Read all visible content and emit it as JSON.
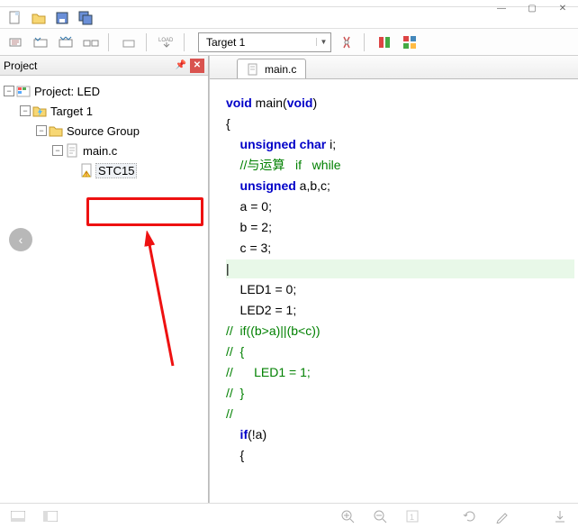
{
  "window": {
    "min": "—",
    "max": "▢",
    "close": "✕"
  },
  "toolbar": {
    "target_label": "Target 1"
  },
  "project": {
    "panel_title": "Project",
    "root": "Project: LED",
    "target": "Target 1",
    "group": "Source Group",
    "file": "main.c",
    "header": "STC15"
  },
  "editor": {
    "tab": "main.c",
    "code": {
      "l1a": "void",
      "l1b": " main(",
      "l1c": "void",
      "l1d": ")",
      "l2": "{",
      "l3a": "    unsigned",
      "l3b": " char",
      "l3c": " i;",
      "l4": "    //与运算   if   while",
      "l5a": "    unsigned",
      "l5b": " a,b,c;",
      "l6": "    a = 0;",
      "l7": "    b = 2;",
      "l8": "    c = 3;",
      "l9": "",
      "l10": "    LED1 = 0;",
      "l11": "    LED2 = 1;",
      "l12": "//  if((b>a)||(b<c))",
      "l13": "//  {",
      "l14": "//      LED1 = 1;",
      "l15": "//  }",
      "l16": "//",
      "l17a": "    if",
      "l17b": "(!a)",
      "l18": "    {"
    }
  }
}
